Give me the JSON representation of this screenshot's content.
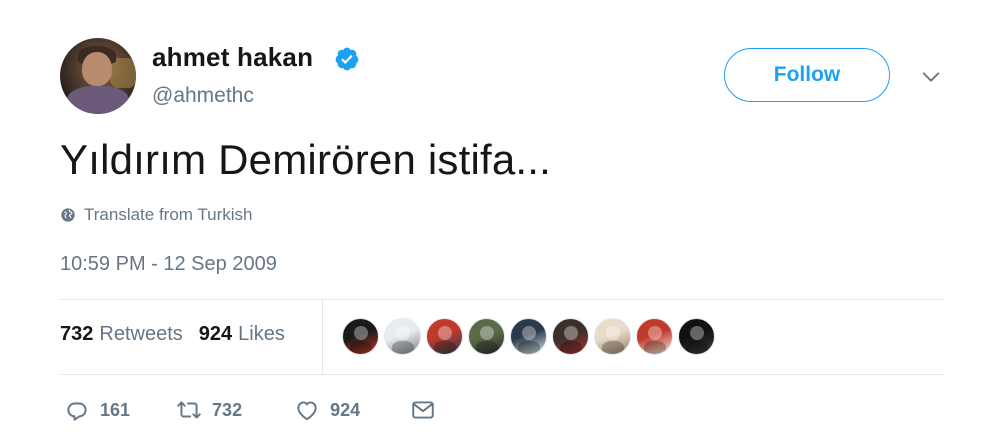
{
  "author": {
    "display_name": "ahmet hakan",
    "handle": "@ahmethc",
    "verified_icon": "verified-badge-icon",
    "avatar": "profile-photo"
  },
  "follow_button": {
    "label": "Follow"
  },
  "more_menu_icon": "chevron-down-icon",
  "tweet": {
    "text": "Yıldırım Demirören istifa...",
    "translate_label": "Translate from Turkish",
    "translate_icon": "globe-icon",
    "timestamp": "10:59 PM - 12 Sep 2009"
  },
  "stats": {
    "retweets_count": "732",
    "retweets_label": "Retweets",
    "likes_count": "924",
    "likes_label": "Likes"
  },
  "likers": [
    {
      "colors": [
        "#1a1a1a",
        "#c0392b"
      ]
    },
    {
      "colors": [
        "#e9ecef",
        "#7a7f86"
      ]
    },
    {
      "colors": [
        "#c0392b",
        "#2c3e50"
      ]
    },
    {
      "colors": [
        "#5b6b4a",
        "#2a2f26"
      ]
    },
    {
      "colors": [
        "#2a3a4a",
        "#dfe6ee"
      ]
    },
    {
      "colors": [
        "#3a2f2a",
        "#b03030"
      ]
    },
    {
      "colors": [
        "#e8dccb",
        "#9a7b5c"
      ]
    },
    {
      "colors": [
        "#c0392b",
        "#f3e9dc"
      ]
    },
    {
      "colors": [
        "#111111",
        "#3b3b3b"
      ]
    }
  ],
  "actions": {
    "reply_icon": "reply-icon",
    "reply_count": "161",
    "retweet_icon": "retweet-icon",
    "retweet_count": "732",
    "like_icon": "heart-icon",
    "like_count": "924",
    "dm_icon": "envelope-icon"
  },
  "colors": {
    "accent": "#1da1f2",
    "text_primary": "#14171a",
    "text_secondary": "#657786",
    "divider": "#e1e8ed"
  }
}
